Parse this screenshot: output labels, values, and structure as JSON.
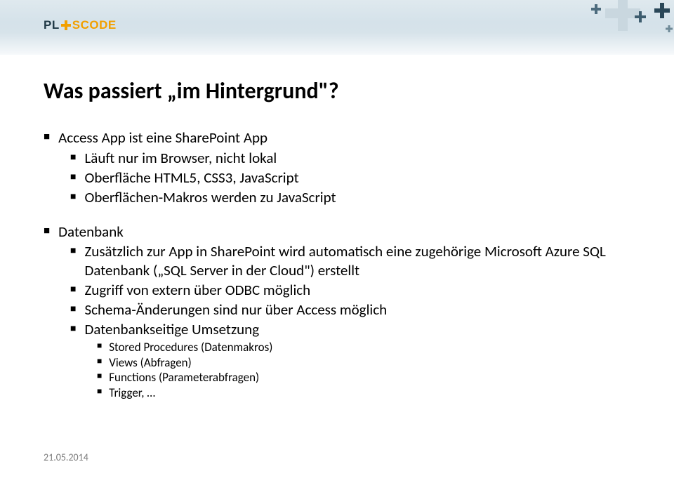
{
  "logo": {
    "part1": "PL",
    "part2": "SCODE"
  },
  "title": "Was passiert „im Hintergrund\"?",
  "bullets": [
    {
      "text": "Access App ist eine SharePoint App",
      "children": [
        {
          "text": "Läuft nur im Browser, nicht lokal"
        },
        {
          "text": "Oberfläche HTML5, CSS3, JavaScript"
        },
        {
          "text": "Oberflächen-Makros werden zu JavaScript"
        }
      ]
    },
    {
      "text": "Datenbank",
      "children": [
        {
          "text": "Zusätzlich zur App in SharePoint wird automatisch eine zugehörige Microsoft Azure SQL Datenbank („SQL Server in der Cloud\") erstellt"
        },
        {
          "text": "Zugriff von extern über ODBC möglich"
        },
        {
          "text": "Schema-Änderungen sind nur über Access möglich"
        },
        {
          "text": "Datenbankseitige Umsetzung",
          "children": [
            {
              "text": "Stored Procedures (Datenmakros)"
            },
            {
              "text": "Views (Abfragen)"
            },
            {
              "text": "Functions (Parameterabfragen)"
            },
            {
              "text": "Trigger, …"
            }
          ]
        }
      ]
    }
  ],
  "footer": {
    "date": "21.05.2014"
  }
}
